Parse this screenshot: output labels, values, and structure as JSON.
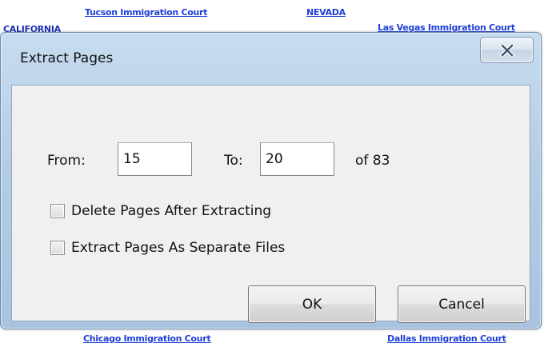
{
  "background_document": {
    "top_links": [
      "Tucson Immigration Court",
      "NEVADA"
    ],
    "heading_left": "CALIFORNIA",
    "link_right": "Las Vegas Immigration Court",
    "bottom_links": [
      "Chicago Immigration Court",
      "Dallas Immigration Court"
    ]
  },
  "dialog": {
    "title": "Extract Pages",
    "close_icon": "close-x-icon",
    "from_label": "From:",
    "from_value": "15",
    "to_label": "To:",
    "to_value": "20",
    "of_label": "of 83",
    "options": [
      {
        "label": "Delete Pages After Extracting",
        "checked": false
      },
      {
        "label": "Extract Pages As Separate Files",
        "checked": false
      }
    ],
    "ok_label": "OK",
    "cancel_label": "Cancel"
  },
  "colors": {
    "link": "#1f3fd6",
    "frame": "#b4cde6",
    "client": "#f0f0f0"
  }
}
